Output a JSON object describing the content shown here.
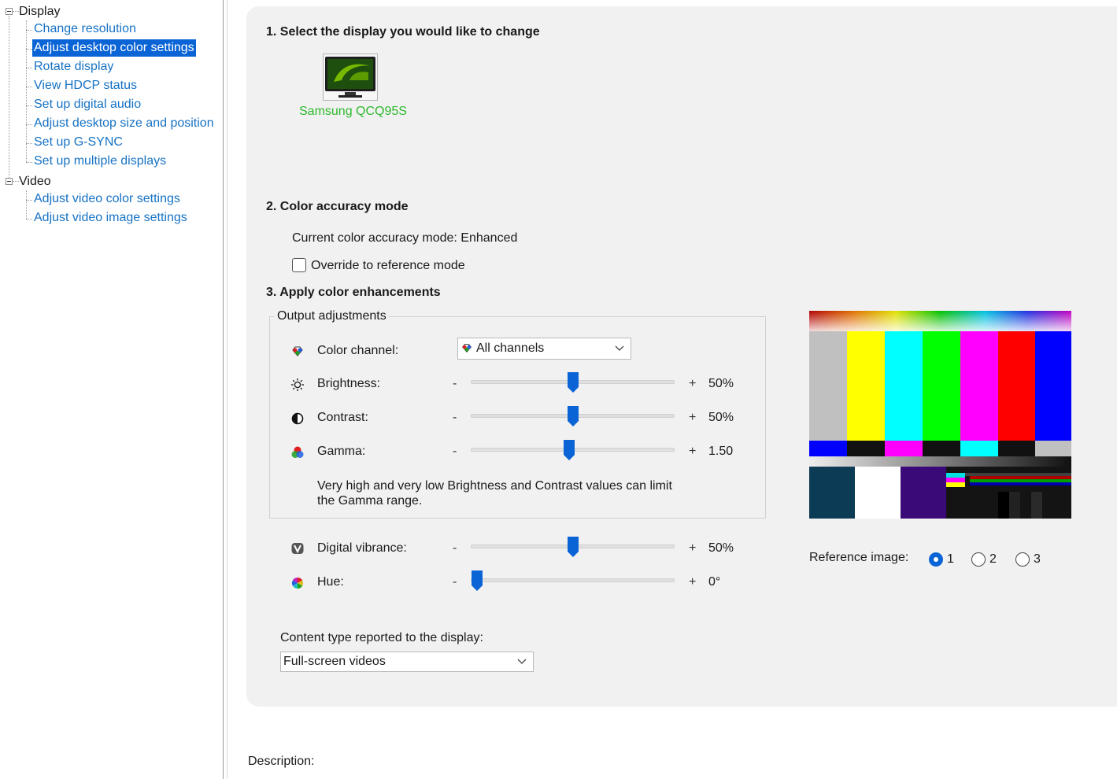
{
  "tree": {
    "categories": [
      {
        "label": "Display",
        "items": [
          "Change resolution",
          "Adjust desktop color settings",
          "Rotate display",
          "View HDCP status",
          "Set up digital audio",
          "Adjust desktop size and position",
          "Set up G-SYNC",
          "Set up multiple displays"
        ]
      },
      {
        "label": "Video",
        "items": [
          "Adjust video color settings",
          "Adjust video image settings"
        ]
      }
    ],
    "selected_item": "Adjust desktop color settings"
  },
  "section1": {
    "heading": "1. Select the display you would like to change",
    "display_name": "Samsung QCQ95S",
    "icon": "monitor-nvidia-icon"
  },
  "section2": {
    "heading": "2. Color accuracy mode",
    "current_mode": "Current color accuracy mode: Enhanced",
    "override_label": "Override to reference mode",
    "override_checked": false
  },
  "section3": {
    "heading": "3. Apply color enhancements",
    "group_label": "Output adjustments",
    "color_channel": {
      "label": "Color channel:",
      "value": "All channels",
      "icon": "rgb-channels-icon"
    },
    "brightness": {
      "label": "Brightness:",
      "minus": "-",
      "plus": "+",
      "value_text": "50%",
      "fraction": 0.5,
      "icon": "sun-icon"
    },
    "contrast": {
      "label": "Contrast:",
      "minus": "-",
      "plus": "+",
      "value_text": "50%",
      "fraction": 0.5,
      "icon": "half-circle-icon"
    },
    "gamma": {
      "label": "Gamma:",
      "minus": "-",
      "plus": "+",
      "value_text": "1.50",
      "fraction": 0.48,
      "icon": "rgb-circles-icon"
    },
    "note": "Very high and very low Brightness and Contrast values can limit the Gamma range.",
    "digital_vibrance": {
      "label": "Digital vibrance:",
      "minus": "-",
      "plus": "+",
      "value_text": "50%",
      "fraction": 0.5,
      "icon": "vibrance-icon"
    },
    "hue": {
      "label": "Hue:",
      "minus": "-",
      "plus": "+",
      "value_text": "0°",
      "fraction": 0.0,
      "icon": "color-wheel-icon"
    },
    "content_type_label": "Content type reported to the display:",
    "content_type_value": "Full-screen videos"
  },
  "reference": {
    "label": "Reference image:",
    "options": [
      "1",
      "2",
      "3"
    ],
    "selected": "1"
  },
  "description_label": "Description:",
  "colors": {
    "accent": "#0a64d6",
    "link": "#1672c4",
    "display_name": "#2db92d"
  }
}
